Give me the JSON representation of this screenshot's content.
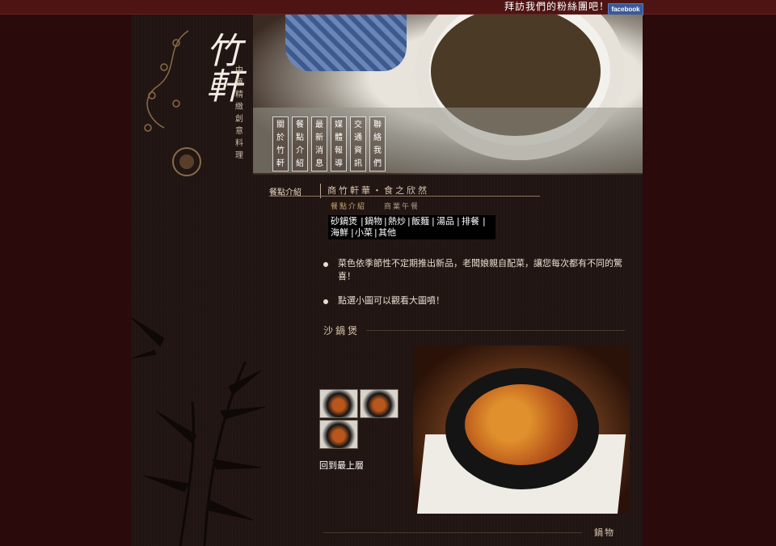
{
  "topbar": {
    "fan_link": "拜訪我們的粉絲團吧！",
    "facebook_badge": "facebook"
  },
  "header": {
    "logo": "竹軒",
    "tagline": "中華精緻創意料理"
  },
  "nav": {
    "items": [
      {
        "label": "關於竹軒"
      },
      {
        "label": "餐點介紹"
      },
      {
        "label": "最新消息"
      },
      {
        "label": "媒體報導"
      },
      {
        "label": "交通資訊"
      },
      {
        "label": "聯絡我們"
      }
    ]
  },
  "breadcrumb": {
    "section": "餐點介紹",
    "slogan": "商竹軒華・食之欣然",
    "sub_active": "餐點介紹",
    "sub_other": "商業午餐"
  },
  "categories": {
    "row1": [
      "砂鍋煲",
      "鍋物",
      "熱炒",
      "飯麵",
      "湯品",
      "排餐"
    ],
    "row2": [
      "海鮮",
      "小菜",
      "其他"
    ]
  },
  "notes": [
    "菜色依季節性不定期推出新品，老闆娘親自配菜，讓您每次都有不同的驚喜！",
    "點選小圖可以觀看大圖噴！"
  ],
  "section": {
    "title": "沙鍋煲",
    "back_to_top": "回到最上層",
    "next_title": "鍋物"
  },
  "colors": {
    "background": "#2a0a0a",
    "topbar": "#4e1414",
    "page": "#211513",
    "facebook": "#3b5998"
  }
}
